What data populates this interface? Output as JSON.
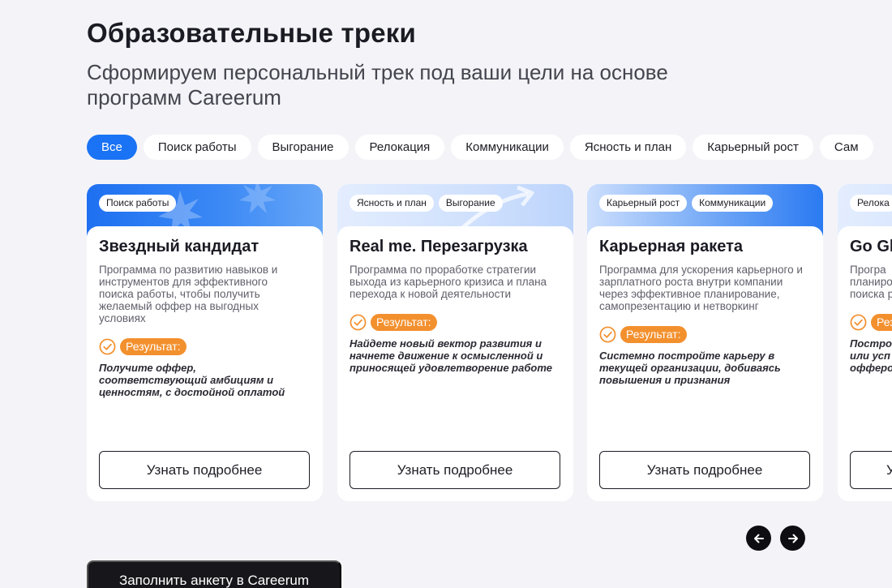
{
  "header": {
    "title": "Образовательные треки",
    "subtitle": "Сформируем персональный трек под ваши цели на основе программ Careerum"
  },
  "filters": [
    "Все",
    "Поиск работы",
    "Выгорание",
    "Релокация",
    "Коммуникации",
    "Ясность и план",
    "Карьерный рост",
    "Сам"
  ],
  "active_filter": "Все",
  "cards": [
    {
      "tags": [
        "Поиск работы"
      ],
      "title": "Звездный кандидат",
      "description": "Программа по развитию навыков и инструментов для эффективного поиска работы, чтобы получить желаемый оффер на выгодных условиях",
      "result_label": "Результат:",
      "result": "Получите оффер, соответствующий амбициям и ценностям, с достойной оплатой",
      "button": "Узнать подробнее"
    },
    {
      "tags": [
        "Ясность и план",
        "Выгорание"
      ],
      "title": "Real me. Перезагрузка",
      "description": "Программа по проработке стратегии выхода из карьерного кризиса и плана перехода к новой деятельности",
      "result_label": "Результат:",
      "result": "Найдете новый вектор развития и начнете движение к осмысленной и приносящей удовлетворение работе",
      "button": "Узнать подробнее"
    },
    {
      "tags": [
        "Карьерный рост",
        "Коммуникации"
      ],
      "title": "Карьерная ракета",
      "description": "Программа для ускорения карьерного и зарплатного роста внутри компании через эффективное планирование, самопрезентацию и нетворкинг",
      "result_label": "Результат:",
      "result": "Системно постройте карьеру в текущей организации, добиваясь повышения и признания",
      "button": "Узнать подробнее"
    },
    {
      "tags": [
        "Релока"
      ],
      "title": "Go Gl",
      "description": "Програ планиро поиска р",
      "result_label": "Рез",
      "result": "Построі или усп офферо",
      "button": "У"
    }
  ],
  "carousel": {
    "prev_icon": "arrow-left-icon",
    "next_icon": "arrow-right-icon"
  },
  "cta": {
    "label": "Заполнить анкету в Careerum"
  },
  "colors": {
    "accent": "#1a73f4",
    "result_badge": "#f3902e",
    "dark": "#16161b"
  }
}
